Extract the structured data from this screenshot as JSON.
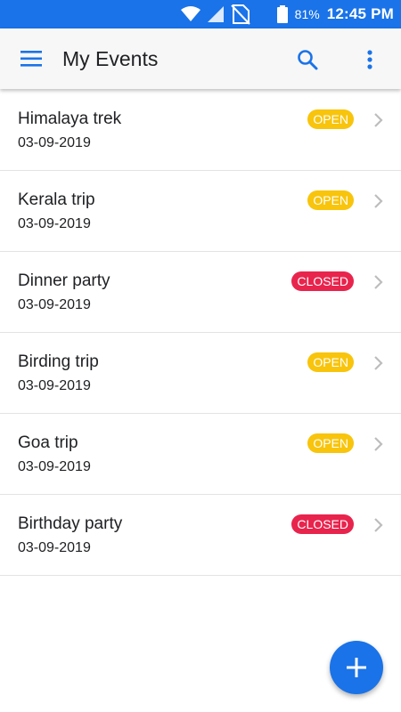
{
  "status_bar": {
    "battery_percent": "81%",
    "time": "12:45 PM",
    "icons": [
      "wifi-icon",
      "signal-icon",
      "no-sim-icon",
      "battery-icon"
    ],
    "color": "#1a73e8"
  },
  "app_bar": {
    "title": "My Events",
    "icons": [
      "menu-icon",
      "search-icon",
      "more-vert-icon"
    ],
    "accent": "#1a73e8"
  },
  "events": [
    {
      "name": "Himalaya trek",
      "date": "03-09-2019",
      "status": "OPEN"
    },
    {
      "name": "Kerala trip",
      "date": "03-09-2019",
      "status": "OPEN"
    },
    {
      "name": "Dinner party",
      "date": "03-09-2019",
      "status": "CLOSED"
    },
    {
      "name": "Birding trip",
      "date": "03-09-2019",
      "status": "OPEN"
    },
    {
      "name": "Goa trip",
      "date": "03-09-2019",
      "status": "OPEN"
    },
    {
      "name": "Birthday party",
      "date": "03-09-2019",
      "status": "CLOSED"
    }
  ],
  "status_colors": {
    "OPEN": "#f8c40c",
    "CLOSED": "#e8244d"
  },
  "fab": {
    "icon": "add-icon",
    "color": "#1a73e8"
  }
}
